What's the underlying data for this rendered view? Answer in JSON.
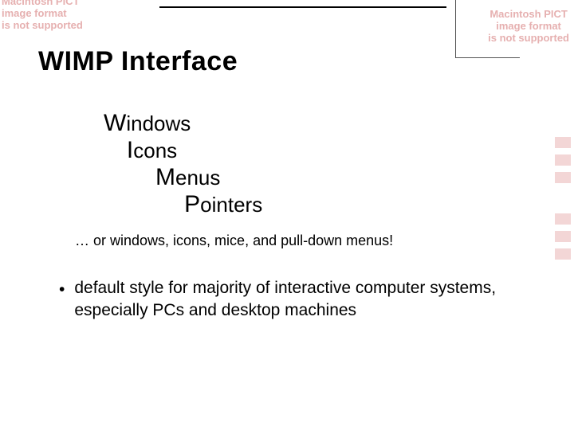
{
  "pict_error": "Macintosh PICT\nimage format\nis not supported",
  "title": "WIMP Interface",
  "acronym": {
    "w_initial": "W",
    "w_rest": "indows",
    "i_initial": "I",
    "i_rest": "cons",
    "m_initial": "M",
    "m_rest": "enus",
    "p_initial": "P",
    "p_rest": "ointers"
  },
  "subcaption": "… or windows, icons, mice, and pull-down menus!",
  "bullet": "default style for majority of interactive computer systems, especially PCs and desktop machines",
  "bullet_marker": "•"
}
